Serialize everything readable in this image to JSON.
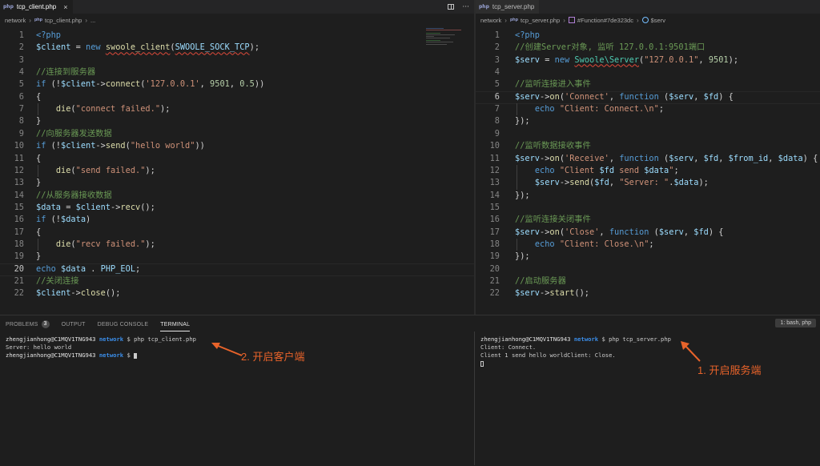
{
  "left_editor": {
    "tab_label": "tcp_client.php",
    "tab_icon": "php",
    "breadcrumb": [
      "network",
      "tcp_client.php",
      "..."
    ],
    "lines": [
      [
        [
          "<?php",
          "k"
        ]
      ],
      [
        [
          "$client",
          "v"
        ],
        [
          " = ",
          "p"
        ],
        [
          "new",
          "k"
        ],
        [
          " ",
          "p"
        ],
        [
          "swoole_client",
          "f",
          "sq"
        ],
        [
          "(",
          "p"
        ],
        [
          "SWOOLE_SOCK_TCP",
          "v",
          "sq"
        ],
        [
          ");",
          "p"
        ]
      ],
      [],
      [
        [
          "//连接到服务器",
          "c"
        ]
      ],
      [
        [
          "if",
          "k"
        ],
        [
          " (!",
          "p"
        ],
        [
          "$client",
          "v"
        ],
        [
          "->",
          "p"
        ],
        [
          "connect",
          "f"
        ],
        [
          "(",
          "p"
        ],
        [
          "'127.0.0.1'",
          "s"
        ],
        [
          ", ",
          "p"
        ],
        [
          "9501",
          "n"
        ],
        [
          ", ",
          "p"
        ],
        [
          "0.5",
          "n"
        ],
        [
          "))",
          "p"
        ]
      ],
      [
        [
          "{",
          "p"
        ]
      ],
      [
        [
          "    ",
          "p"
        ],
        [
          "die",
          "f"
        ],
        [
          "(",
          "p"
        ],
        [
          "\"connect failed.\"",
          "s"
        ],
        [
          ");",
          "p"
        ]
      ],
      [
        [
          "}",
          "p"
        ]
      ],
      [
        [
          "//向服务器发送数据",
          "c"
        ]
      ],
      [
        [
          "if",
          "k"
        ],
        [
          " (!",
          "p"
        ],
        [
          "$client",
          "v"
        ],
        [
          "->",
          "p"
        ],
        [
          "send",
          "f"
        ],
        [
          "(",
          "p"
        ],
        [
          "\"hello world\"",
          "s"
        ],
        [
          "))",
          "p"
        ]
      ],
      [
        [
          "{",
          "p"
        ]
      ],
      [
        [
          "    ",
          "p"
        ],
        [
          "die",
          "f"
        ],
        [
          "(",
          "p"
        ],
        [
          "\"send failed.\"",
          "s"
        ],
        [
          ");",
          "p"
        ]
      ],
      [
        [
          "}",
          "p"
        ]
      ],
      [
        [
          "//从服务器接收数据",
          "c"
        ]
      ],
      [
        [
          "$data",
          "v"
        ],
        [
          " = ",
          "p"
        ],
        [
          "$client",
          "v"
        ],
        [
          "->",
          "p"
        ],
        [
          "recv",
          "f"
        ],
        [
          "();",
          "p"
        ]
      ],
      [
        [
          "if",
          "k"
        ],
        [
          " (!",
          "p"
        ],
        [
          "$data",
          "v"
        ],
        [
          ")",
          "p"
        ]
      ],
      [
        [
          "{",
          "p"
        ]
      ],
      [
        [
          "    ",
          "p"
        ],
        [
          "die",
          "f"
        ],
        [
          "(",
          "p"
        ],
        [
          "\"recv failed.\"",
          "s"
        ],
        [
          ");",
          "p"
        ]
      ],
      [
        [
          "}",
          "p"
        ]
      ],
      [
        [
          "echo",
          "k"
        ],
        [
          " ",
          "p"
        ],
        [
          "$data",
          "v"
        ],
        [
          " . ",
          "p"
        ],
        [
          "PHP_EOL",
          "v"
        ],
        [
          ";",
          "p"
        ]
      ],
      [
        [
          "//关闭连接",
          "c"
        ]
      ],
      [
        [
          "$client",
          "v"
        ],
        [
          "->",
          "p"
        ],
        [
          "close",
          "f"
        ],
        [
          "();",
          "p"
        ]
      ]
    ]
  },
  "right_editor": {
    "tab_label": "tcp_server.php",
    "tab_icon": "php",
    "breadcrumb": [
      "network",
      "tcp_server.php",
      "#Function#7de323dc",
      "$serv"
    ],
    "lines": [
      [
        [
          "<?php",
          "k"
        ]
      ],
      [
        [
          "//创建Server对象, 监听 127.0.0.1:9501端口",
          "c"
        ]
      ],
      [
        [
          "$serv",
          "v"
        ],
        [
          " = ",
          "p"
        ],
        [
          "new",
          "k"
        ],
        [
          " ",
          "p"
        ],
        [
          "Swoole\\Server",
          "t",
          "sq"
        ],
        [
          "(",
          "p"
        ],
        [
          "\"127.0.0.1\"",
          "s"
        ],
        [
          ", ",
          "p"
        ],
        [
          "9501",
          "n"
        ],
        [
          ");",
          "p"
        ]
      ],
      [],
      [
        [
          "//监听连接进入事件",
          "c"
        ]
      ],
      [
        [
          "$serv",
          "v"
        ],
        [
          "->",
          "p"
        ],
        [
          "on",
          "f"
        ],
        [
          "(",
          "p"
        ],
        [
          "'Connect'",
          "s"
        ],
        [
          ", ",
          "p"
        ],
        [
          "function",
          "k"
        ],
        [
          " (",
          "p"
        ],
        [
          "$serv",
          "v"
        ],
        [
          ", ",
          "p"
        ],
        [
          "$fd",
          "v"
        ],
        [
          ") {",
          "p"
        ]
      ],
      [
        [
          "    ",
          "p"
        ],
        [
          "echo",
          "k"
        ],
        [
          " ",
          "p"
        ],
        [
          "\"Client: Connect.\\n\"",
          "s"
        ],
        [
          ";",
          "p"
        ]
      ],
      [
        [
          "});",
          "p"
        ]
      ],
      [],
      [
        [
          "//监听数据接收事件",
          "c"
        ]
      ],
      [
        [
          "$serv",
          "v"
        ],
        [
          "->",
          "p"
        ],
        [
          "on",
          "f"
        ],
        [
          "(",
          "p"
        ],
        [
          "'Receive'",
          "s"
        ],
        [
          ", ",
          "p"
        ],
        [
          "function",
          "k"
        ],
        [
          " (",
          "p"
        ],
        [
          "$serv",
          "v"
        ],
        [
          ", ",
          "p"
        ],
        [
          "$fd",
          "v"
        ],
        [
          ", ",
          "p"
        ],
        [
          "$from_id",
          "v"
        ],
        [
          ", ",
          "p"
        ],
        [
          "$data",
          "v"
        ],
        [
          ") {",
          "p"
        ]
      ],
      [
        [
          "    ",
          "p"
        ],
        [
          "echo",
          "k"
        ],
        [
          " ",
          "p"
        ],
        [
          "\"Client ",
          "s"
        ],
        [
          "$fd",
          "v"
        ],
        [
          " send ",
          "s"
        ],
        [
          "$data",
          "v"
        ],
        [
          "\"",
          "s"
        ],
        [
          ";",
          "p"
        ]
      ],
      [
        [
          "    ",
          "p"
        ],
        [
          "$serv",
          "v"
        ],
        [
          "->",
          "p"
        ],
        [
          "send",
          "f"
        ],
        [
          "(",
          "p"
        ],
        [
          "$fd",
          "v"
        ],
        [
          ", ",
          "p"
        ],
        [
          "\"Server: \"",
          "s"
        ],
        [
          ".",
          "p"
        ],
        [
          "$data",
          "v"
        ],
        [
          ");",
          "p"
        ]
      ],
      [
        [
          "});",
          "p"
        ]
      ],
      [],
      [
        [
          "//监听连接关闭事件",
          "c"
        ]
      ],
      [
        [
          "$serv",
          "v"
        ],
        [
          "->",
          "p"
        ],
        [
          "on",
          "f"
        ],
        [
          "(",
          "p"
        ],
        [
          "'Close'",
          "s"
        ],
        [
          ", ",
          "p"
        ],
        [
          "function",
          "k"
        ],
        [
          " (",
          "p"
        ],
        [
          "$serv",
          "v"
        ],
        [
          ", ",
          "p"
        ],
        [
          "$fd",
          "v"
        ],
        [
          ") {",
          "p"
        ]
      ],
      [
        [
          "    ",
          "p"
        ],
        [
          "echo",
          "k"
        ],
        [
          " ",
          "p"
        ],
        [
          "\"Client: Close.\\n\"",
          "s"
        ],
        [
          ";",
          "p"
        ]
      ],
      [
        [
          "});",
          "p"
        ]
      ],
      [],
      [
        [
          "//启动服务器",
          "c"
        ]
      ],
      [
        [
          "$serv",
          "v"
        ],
        [
          "->",
          "p"
        ],
        [
          "start",
          "f"
        ],
        [
          "();",
          "p"
        ]
      ]
    ]
  },
  "panel": {
    "tabs": [
      {
        "label": "PROBLEMS",
        "badge": "3"
      },
      {
        "label": "OUTPUT"
      },
      {
        "label": "DEBUG CONSOLE"
      },
      {
        "label": "TERMINAL",
        "active": true
      }
    ],
    "shell_select": "1: bash, php"
  },
  "left_terminal": {
    "lines": [
      {
        "host": "zhengjianhong@C1MQV1TNG943",
        "dir": "network",
        "cmd": "$ php tcp_client.php"
      },
      {
        "text": "Server: hello world"
      },
      {
        "host": "zhengjianhong@C1MQV1TNG943",
        "dir": "network",
        "cmd": "$ ",
        "cursor": "solid"
      }
    ]
  },
  "right_terminal": {
    "lines": [
      {
        "host": "zhengjianhong@C1MQV1TNG943",
        "dir": "network",
        "cmd": "$ php tcp_server.php"
      },
      {
        "text": "Client: Connect."
      },
      {
        "text": "Client 1 send hello worldClient: Close."
      },
      {
        "cursor": "hollow"
      }
    ]
  },
  "annotations": {
    "client": "2. 开启客户端",
    "server": "1. 开启服务端",
    "color": "#e8632a"
  },
  "colors": {
    "keyword": "#569cd6",
    "variable": "#9cdcfe",
    "string": "#ce9178",
    "number": "#b5cea8",
    "comment": "#6a9955",
    "function": "#dcdcaa",
    "class": "#4ec9b0",
    "terminal_dir": "#3b8eea"
  }
}
